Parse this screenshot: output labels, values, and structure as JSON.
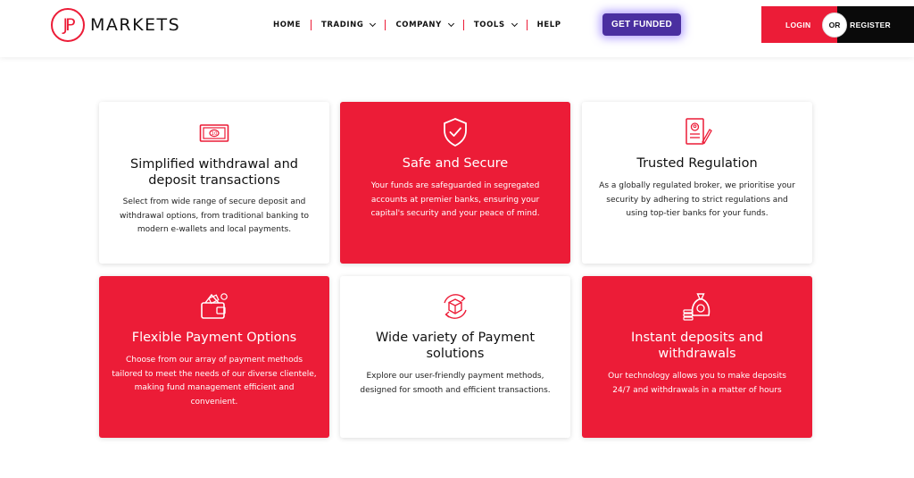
{
  "header": {
    "logo_mark": "JP",
    "logo_text": "MARKETS",
    "nav": [
      {
        "label": "HOME",
        "dropdown": false
      },
      {
        "label": "TRADING",
        "dropdown": true
      },
      {
        "label": "COMPANY",
        "dropdown": true
      },
      {
        "label": "TOOLS",
        "dropdown": true
      },
      {
        "label": "HELP",
        "dropdown": false
      }
    ],
    "cta": "GET FUNDED",
    "login": "LOGIN",
    "or": "OR",
    "register": "REGISTER"
  },
  "colors": {
    "brand_red": "#ec1c37",
    "cta_purple": "#4a2fa0",
    "black": "#0a0a0a"
  },
  "cards": [
    {
      "title": "Simplified withdrawal and deposit transactions",
      "text": "Select from wide range of secure deposit and withdrawal options, from traditional banking to modern e-wallets and local payments.",
      "icon": "banknote-icon",
      "style": "white"
    },
    {
      "title": "Safe and Secure",
      "text": "Your funds are safeguarded in segregated accounts at premier banks, ensuring your capital's security and your peace of mind.",
      "icon": "shield-check-icon",
      "style": "red"
    },
    {
      "title": "Trusted Regulation",
      "text": "As a globally regulated broker, we prioritise your security by adhering to strict regulations and using top-tier banks for your funds.",
      "icon": "certificate-icon",
      "style": "white"
    },
    {
      "title": "Flexible Payment Options",
      "text": "Choose from our array of payment methods tailored to meet the needs of our diverse clientele, making fund management efficient and convenient.",
      "icon": "wallet-icon",
      "style": "red"
    },
    {
      "title": "Wide variety of Payment solutions",
      "text": "Explore our user-friendly payment methods, designed for smooth and efficient transactions.",
      "icon": "box-cycle-icon",
      "style": "white"
    },
    {
      "title": "Instant deposits and withdrawals",
      "text": "Our technology allows you to make deposits 24/7 and withdrawals in a matter of hours",
      "icon": "money-bag-icon",
      "style": "red"
    }
  ]
}
